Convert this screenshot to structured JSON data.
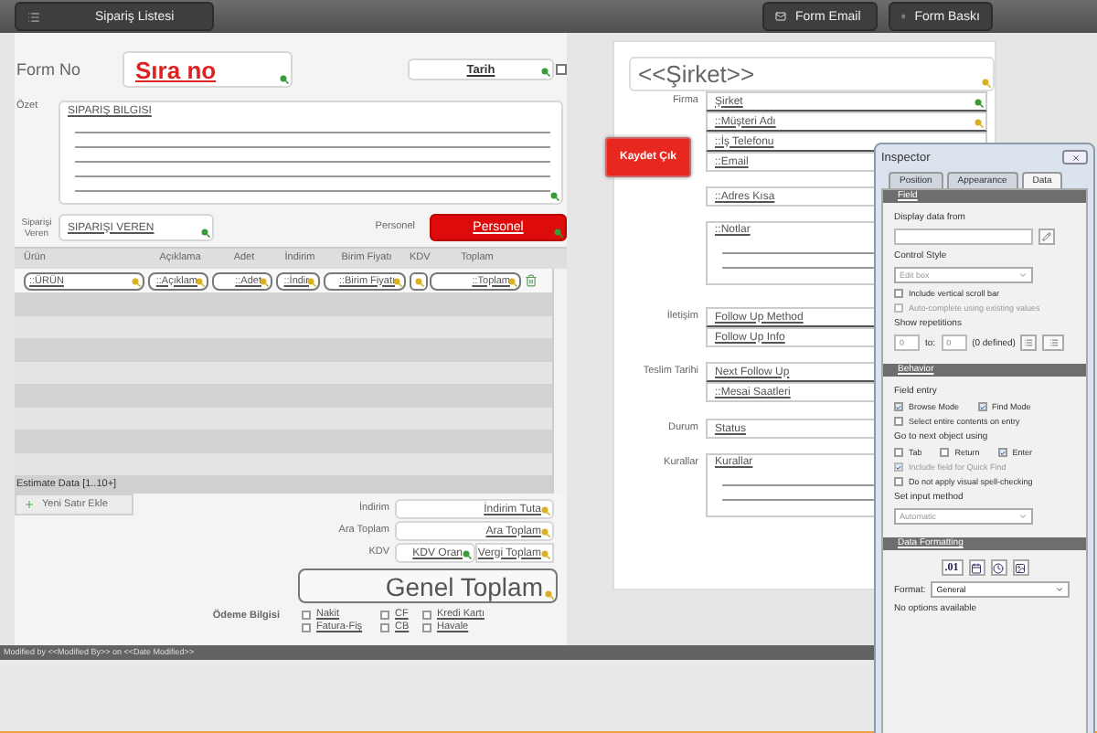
{
  "header": {
    "list_button": "Sipariş Listesi",
    "buttons": [
      "Form Email",
      "Form Baskı"
    ]
  },
  "order": {
    "form_no_label": "Form No",
    "form_no": "Sıra no",
    "date": "Tarih",
    "summary_label": "Özet",
    "summary": "SIPARIŞ BILGISI",
    "orderer_label": "Siparişi Veren",
    "orderer": "SIPARIŞI VEREN",
    "staff_label": "Personel",
    "staff": "Personel"
  },
  "line_items": {
    "columns": [
      "Ürün",
      "Açıklama",
      "Adet",
      "İndirim",
      "Birim Fiyatı",
      "KDV",
      "Toplam"
    ],
    "fields": [
      {
        "kind": "field",
        "value": "::ÜRÜN"
      },
      {
        "kind": "field",
        "value": "::Açıklam"
      },
      {
        "kind": "field",
        "value": "::Adet"
      },
      {
        "kind": "field",
        "value": "::İndir"
      },
      {
        "kind": "field",
        "value": "::Birim Fiyatı"
      },
      {
        "kind": "blank"
      },
      {
        "kind": "field",
        "value": "::Toplam"
      }
    ],
    "portal_label": "Estimate Data [1..10+]",
    "add_row_button": "Yeni Satır Ekle"
  },
  "totals": [
    {
      "label": "İndirim",
      "values": [
        "İndirim Tuta"
      ]
    },
    {
      "label": "Ara Toplam",
      "values": [
        "Ara Toplam"
      ]
    },
    {
      "label": "KDV",
      "values": [
        "KDV Oran",
        "Vergi Toplam"
      ]
    }
  ],
  "grand_total": "Genel Toplam",
  "payment": {
    "label": "Ödeme Bilgisi",
    "options": [
      {
        "label": "Nakit",
        "checked": false
      },
      {
        "label": "CF",
        "checked": false
      },
      {
        "label": "Kredi Kartı",
        "checked": false
      },
      {
        "label": "Fatura-Fiş",
        "checked": false
      },
      {
        "label": "CB",
        "checked": false
      },
      {
        "label": "Havale",
        "checked": false
      }
    ]
  },
  "footer": "Modified by <<Modified By>> on <<Date Modified>>",
  "company": {
    "title": "<<Şirket>>",
    "save_button": "Kaydet Çık",
    "groups": [
      {
        "label": "Firma",
        "fields": [
          "Şirket",
          "::Müşteri Adı",
          "::İş Telefonu",
          "::Email"
        ],
        "multiline": false
      },
      {
        "fields": [
          "::Adres Kısa"
        ],
        "multiline": false
      },
      {
        "fields": [
          "::Notlar"
        ],
        "multiline": true
      },
      {
        "label": "İletişim",
        "fields": [
          "Follow Up Method",
          "Follow Up Info"
        ],
        "multiline": false
      },
      {
        "label": "Teslim Tarihi",
        "fields": [
          "Next Follow Up",
          "::Mesai Saatleri"
        ],
        "multiline": false
      },
      {
        "label": "Durum",
        "fields": [
          "Status"
        ],
        "multiline": false
      },
      {
        "label": "Kurallar",
        "fields": [
          "Kurallar"
        ],
        "multiline": true
      }
    ]
  },
  "inspector": {
    "title": "Inspector",
    "tabs": [
      {
        "label": "Position",
        "selected": false
      },
      {
        "label": "Appearance",
        "selected": false
      },
      {
        "label": "Data",
        "selected": true
      }
    ],
    "sections": [
      {
        "title": "Field",
        "items": [
          {
            "kind": "label",
            "text": "Display data from"
          },
          {
            "kind": "input"
          },
          {
            "kind": "label",
            "text": "Control Style"
          },
          {
            "kind": "select",
            "value": "Edit box",
            "disabled": true
          },
          {
            "kind": "checkboxes",
            "options": [
              {
                "label": "Include vertical scroll bar",
                "checked": false,
                "disabled": false
              }
            ]
          },
          {
            "kind": "checkboxes",
            "options": [
              {
                "label": "Auto-complete using existing values",
                "checked": false,
                "disabled": true
              }
            ]
          },
          {
            "kind": "label",
            "text": "Show repetitions"
          },
          {
            "kind": "repetitions",
            "from": "0",
            "to_label": "to:",
            "to": "0",
            "defined": "(0 defined)"
          }
        ]
      },
      {
        "title": "Behavior",
        "items": [
          {
            "kind": "label",
            "text": "Field entry"
          },
          {
            "kind": "checkboxes",
            "options": [
              {
                "label": "Browse Mode",
                "checked": true,
                "disabled": false
              },
              {
                "label": "Find Mode",
                "checked": true,
                "disabled": false
              }
            ]
          },
          {
            "kind": "checkboxes",
            "options": [
              {
                "label": "Select entire contents on entry",
                "checked": false,
                "disabled": false
              }
            ]
          },
          {
            "kind": "label",
            "text": "Go to next object using"
          },
          {
            "kind": "checkboxes",
            "options": [
              {
                "label": "Tab",
                "checked": false,
                "disabled": false
              },
              {
                "label": "Return",
                "checked": false,
                "disabled": false
              },
              {
                "label": "Enter",
                "checked": true,
                "disabled": false
              }
            ]
          },
          {
            "kind": "checkboxes",
            "options": [
              {
                "label": "Include field for Quick Find",
                "checked": true,
                "disabled": true
              }
            ]
          },
          {
            "kind": "checkboxes",
            "options": [
              {
                "label": "Do not apply visual spell-checking",
                "checked": false,
                "disabled": false
              }
            ]
          },
          {
            "kind": "label",
            "text": "Set input method"
          },
          {
            "kind": "select",
            "value": "Automatic",
            "disabled": true
          }
        ]
      },
      {
        "title": "Data Formatting",
        "items": [
          {
            "kind": "format_icons",
            "number_label": ".01"
          },
          {
            "kind": "labeled_select",
            "label": "Format:",
            "value": "General"
          },
          {
            "kind": "note",
            "text": "No options available"
          }
        ]
      }
    ]
  }
}
